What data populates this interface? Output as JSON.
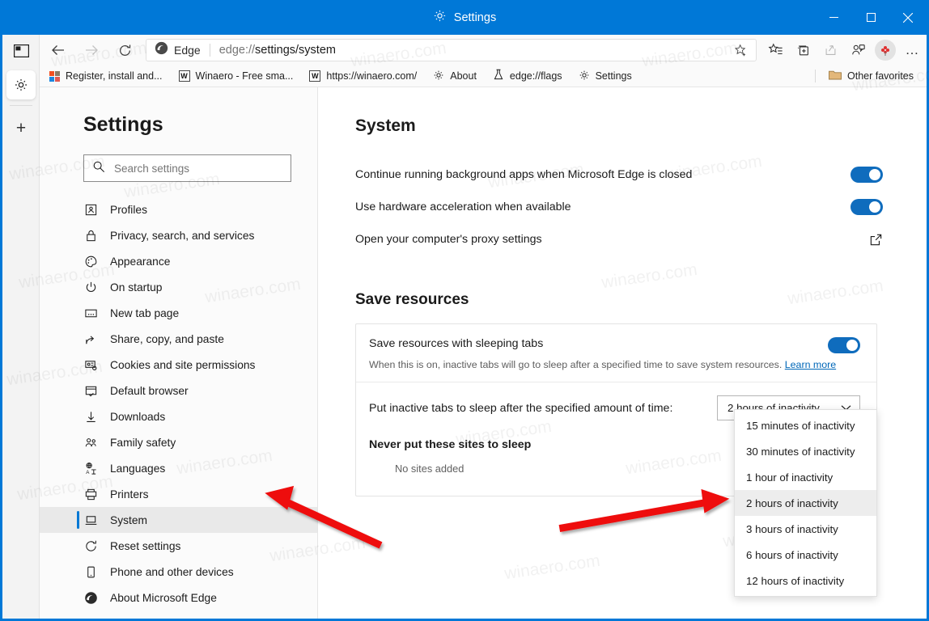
{
  "window": {
    "title": "Settings",
    "title_icon": "gear-icon",
    "accent_color": "#0078d7",
    "minimize": "─",
    "maximize": "□",
    "close": "✕"
  },
  "vertical_tabs": {
    "panel_toggle_icon": "tab-panel-icon",
    "active_tab_icon": "gear-icon",
    "new_tab_label": "+"
  },
  "toolbar": {
    "back_icon": "back-arrow-icon",
    "forward_icon": "forward-arrow-icon",
    "refresh_icon": "refresh-icon",
    "site_name": "Edge",
    "url_prefix": "edge://",
    "url_path": "settings/system",
    "url_full": "edge://settings/system",
    "favorite_icon": "star-add-icon",
    "icons": [
      {
        "name": "favorites-icon",
        "glyph": "☆"
      },
      {
        "name": "collections-icon",
        "glyph": "⧉"
      },
      {
        "name": "share-icon",
        "glyph": "↗"
      },
      {
        "name": "profile-icon",
        "glyph": "☺"
      }
    ],
    "avatar_label": "avatar",
    "more_label": "…"
  },
  "favorites_bar": {
    "items": [
      {
        "label": "Register, install and...",
        "icon": "ms-squares-icon"
      },
      {
        "label": "Winaero - Free sma...",
        "icon": "w-favicon"
      },
      {
        "label": "https://winaero.com/",
        "icon": "w-favicon"
      },
      {
        "label": "About",
        "icon": "gear-icon"
      },
      {
        "label": "edge://flags",
        "icon": "flask-icon"
      },
      {
        "label": "Settings",
        "icon": "gear-icon"
      }
    ],
    "other_favorites": {
      "label": "Other favorites",
      "icon": "folder-icon"
    }
  },
  "sidebar": {
    "title": "Settings",
    "search": {
      "placeholder": "Search settings",
      "value": "",
      "icon": "search-icon"
    },
    "items": [
      {
        "label": "Profiles",
        "icon": "profile-card-icon",
        "selected": false
      },
      {
        "label": "Privacy, search, and services",
        "icon": "lock-icon",
        "selected": false
      },
      {
        "label": "Appearance",
        "icon": "palette-icon",
        "selected": false
      },
      {
        "label": "On startup",
        "icon": "power-icon",
        "selected": false
      },
      {
        "label": "New tab page",
        "icon": "new-tab-icon",
        "selected": false
      },
      {
        "label": "Share, copy, and paste",
        "icon": "share-icon",
        "selected": false
      },
      {
        "label": "Cookies and site permissions",
        "icon": "cookies-icon",
        "selected": false
      },
      {
        "label": "Default browser",
        "icon": "browser-check-icon",
        "selected": false
      },
      {
        "label": "Downloads",
        "icon": "download-icon",
        "selected": false
      },
      {
        "label": "Family safety",
        "icon": "family-icon",
        "selected": false
      },
      {
        "label": "Languages",
        "icon": "languages-icon",
        "selected": false
      },
      {
        "label": "Printers",
        "icon": "printer-icon",
        "selected": false
      },
      {
        "label": "System",
        "icon": "system-icon",
        "selected": true
      },
      {
        "label": "Reset settings",
        "icon": "reset-icon",
        "selected": false
      },
      {
        "label": "Phone and other devices",
        "icon": "phone-icon",
        "selected": false
      },
      {
        "label": "About Microsoft Edge",
        "icon": "edge-logo-icon",
        "selected": false
      }
    ]
  },
  "main": {
    "heading": "System",
    "settings_rows": [
      {
        "label": "Continue running background apps when Microsoft Edge is closed",
        "control": "toggle",
        "state": "on"
      },
      {
        "label": "Use hardware acceleration when available",
        "control": "toggle",
        "state": "on"
      },
      {
        "label": "Open your computer's proxy settings",
        "control": "external-link",
        "state": ""
      }
    ],
    "save_resources": {
      "heading": "Save resources",
      "sleeping_tabs": {
        "title": "Save resources with sleeping tabs",
        "description": "When this is on, inactive tabs will go to sleep after a specified time to save system resources.",
        "learn_more": "Learn more",
        "toggle_state": "on"
      },
      "sleep_timer": {
        "label": "Put inactive tabs to sleep after the specified amount of time:",
        "selected": "2 hours of inactivity",
        "chevron": "chevron-down-icon",
        "options": [
          "15 minutes of inactivity",
          "30 minutes of inactivity",
          "1 hour of inactivity",
          "2 hours of inactivity",
          "3 hours of inactivity",
          "6 hours of inactivity",
          "12 hours of inactivity"
        ],
        "highlighted_option": "2 hours of inactivity"
      },
      "never_sleep": {
        "title": "Never put these sites to sleep",
        "empty_text": "No sites added"
      }
    }
  },
  "watermark": {
    "text": "winaero.com"
  },
  "annotations": {
    "arrow_color": "#ee1111",
    "arrow_1_target": "sidebar-item-system",
    "arrow_2_target": "dropdown-option-2-hours"
  }
}
